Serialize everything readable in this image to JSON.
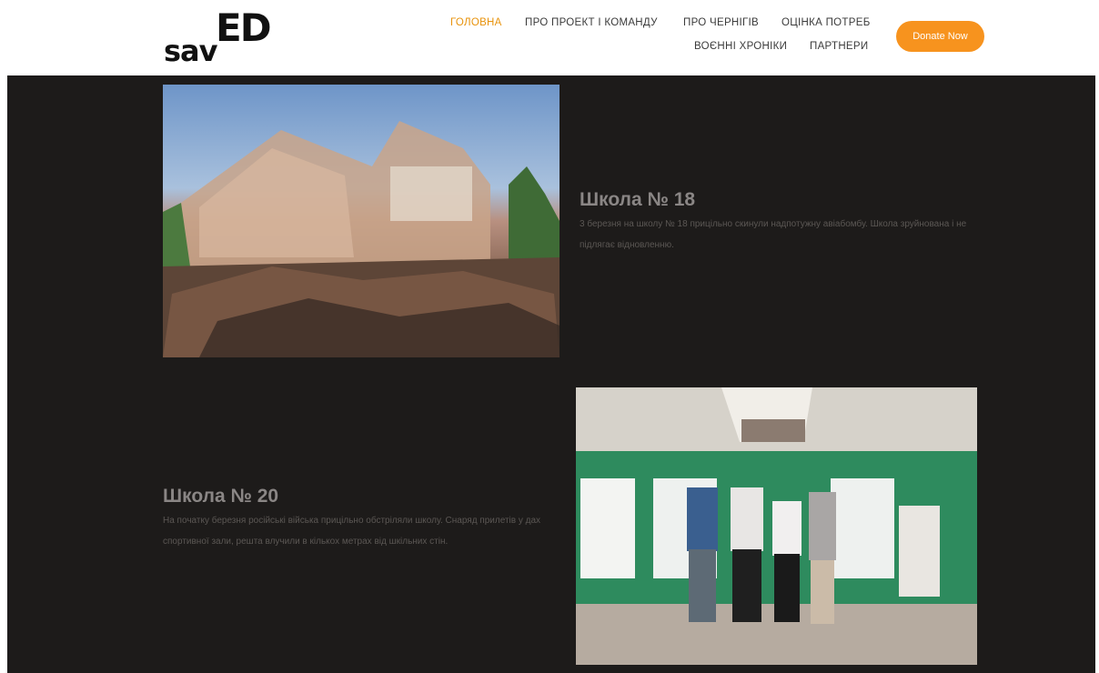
{
  "header": {
    "logo": {
      "part1": "sav",
      "part2": "ED"
    },
    "nav": [
      {
        "label": "ГОЛОВНА",
        "active": true
      },
      {
        "label": "ПРО ПРОЕКТ І КОМАНДУ"
      },
      {
        "label": "ПРО ЧЕРНІГІВ"
      },
      {
        "label": "ОЦІНКА ПОТРЕБ"
      },
      {
        "label": "ВОЄННІ ХРОНІКИ"
      },
      {
        "label": "ПАРТНЕРИ"
      }
    ],
    "donate_label": "Donate Now"
  },
  "sections": [
    {
      "title": "Школа № 18",
      "description": "3 березня на школу № 18 прицільно скинули надпотужну авіабомбу. Школа зруйнована і не підлягає відновленню."
    },
    {
      "title": "Школа № 20",
      "description": "На початку березня російські війська прицільно обстріляли школу. Снаряд прилетів у дах спортивної зали, решта влучили в кількох метрах від шкільних стін."
    }
  ],
  "colors": {
    "accent": "#f7931e",
    "nav_active": "#e8930c",
    "background": "#1d1b1a"
  }
}
